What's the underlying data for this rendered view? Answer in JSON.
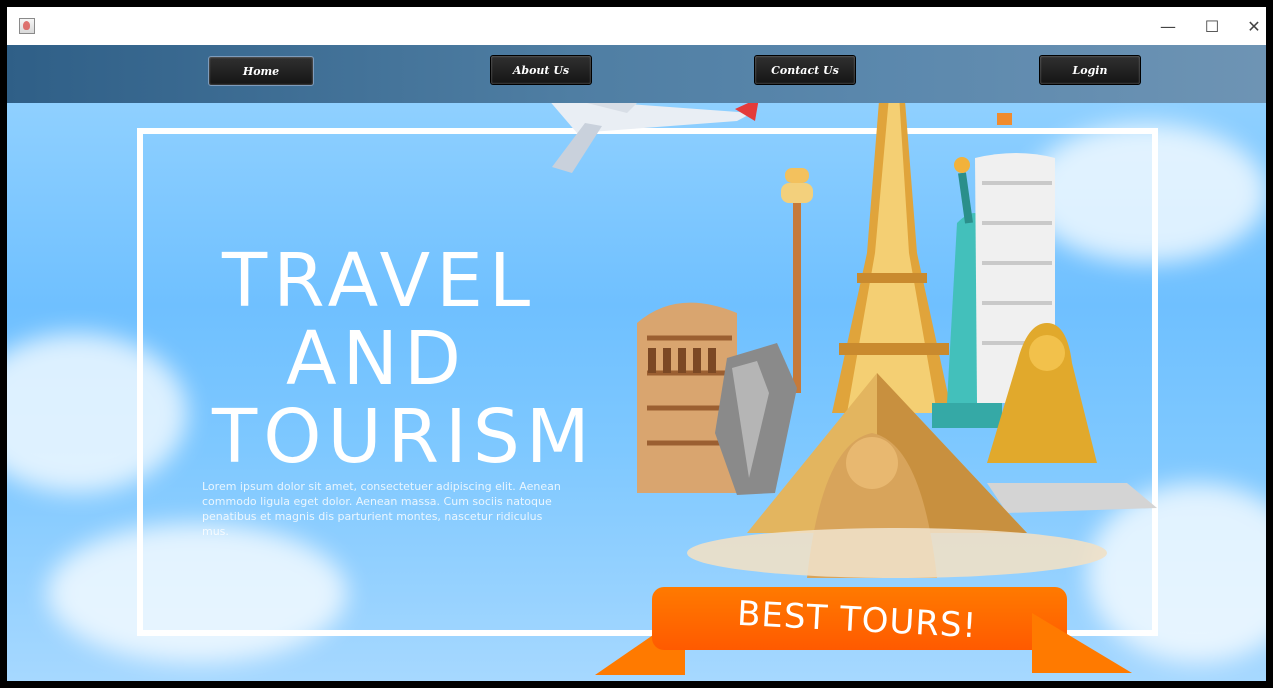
{
  "window": {
    "title": "",
    "controls": {
      "minimize": "—",
      "maximize": "☐",
      "close": "✕"
    }
  },
  "nav": {
    "home": "Home",
    "about": "About Us",
    "contact": "Contact Us",
    "login": "Login"
  },
  "hero": {
    "headline": [
      "TRAVEL",
      "AND",
      "TOURISM"
    ],
    "body_text": "Lorem ipsum dolor sit amet, consectetuer adipiscing elit. Aenean commodo ligula eget dolor. Aenean massa. Cum sociis natoque penatibus et magnis dis parturient montes, nascetur ridiculus mus.",
    "ribbon_text": "BEST TOURS!",
    "illustration": "world-landmarks-illustration"
  },
  "colors": {
    "sky": "#7ec8ff",
    "frame": "#ffffff",
    "ribbon": "#ff7a00",
    "nav": "#4f7ea3"
  }
}
